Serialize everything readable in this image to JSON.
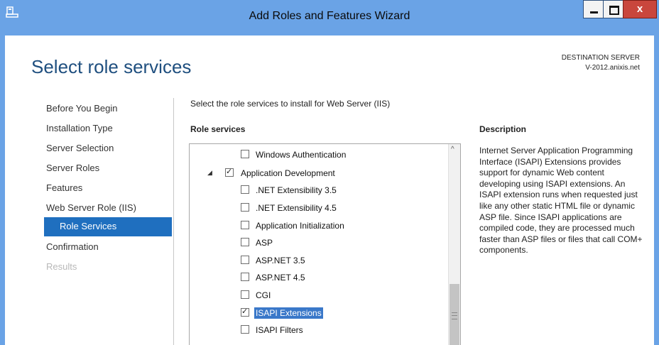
{
  "window": {
    "title": "Add Roles and Features Wizard",
    "close_glyph": "x"
  },
  "page": {
    "title": "Select role services",
    "destination_label": "DESTINATION SERVER",
    "destination_server": "V-2012.anixis.net"
  },
  "nav": {
    "items": [
      {
        "label": "Before You Begin",
        "state": "normal"
      },
      {
        "label": "Installation Type",
        "state": "normal"
      },
      {
        "label": "Server Selection",
        "state": "normal"
      },
      {
        "label": "Server Roles",
        "state": "normal"
      },
      {
        "label": "Features",
        "state": "normal"
      },
      {
        "label": "Web Server Role (IIS)",
        "state": "normal"
      },
      {
        "label": "Role Services",
        "state": "selected"
      },
      {
        "label": "Confirmation",
        "state": "normal"
      },
      {
        "label": "Results",
        "state": "disabled"
      }
    ]
  },
  "main": {
    "instruction": "Select the role services to install for Web Server (IIS)",
    "role_services_header": "Role services",
    "description_header": "Description",
    "description_text": "Internet Server Application Programming Interface (ISAPI) Extensions provides support for dynamic Web content developing using ISAPI extensions. An ISAPI extension runs when requested just like any other static HTML file or dynamic ASP file. Since ISAPI applications are compiled code, they are processed much faster than ASP files or files that call COM+ components."
  },
  "tree": {
    "items": [
      {
        "label": "Windows Authentication",
        "checked": false,
        "level": 2
      },
      {
        "label": "Application Development",
        "checked": true,
        "level": 1,
        "expanded": true
      },
      {
        "label": ".NET Extensibility 3.5",
        "checked": false,
        "level": 2
      },
      {
        "label": ".NET Extensibility 4.5",
        "checked": false,
        "level": 2
      },
      {
        "label": "Application Initialization",
        "checked": false,
        "level": 2
      },
      {
        "label": "ASP",
        "checked": false,
        "level": 2
      },
      {
        "label": "ASP.NET 3.5",
        "checked": false,
        "level": 2
      },
      {
        "label": "ASP.NET 4.5",
        "checked": false,
        "level": 2
      },
      {
        "label": "CGI",
        "checked": false,
        "level": 2
      },
      {
        "label": "ISAPI Extensions",
        "checked": true,
        "level": 2,
        "highlighted": true
      },
      {
        "label": "ISAPI Filters",
        "checked": false,
        "level": 2
      }
    ]
  },
  "icons": {
    "expanded": "◢",
    "scroll_up": "^",
    "checkmark": "✓"
  },
  "colors": {
    "titlebar": "#6aa3e6",
    "accent": "#1f6fbf",
    "close_button": "#c9463d",
    "selection_highlight": "#3a78c9"
  }
}
